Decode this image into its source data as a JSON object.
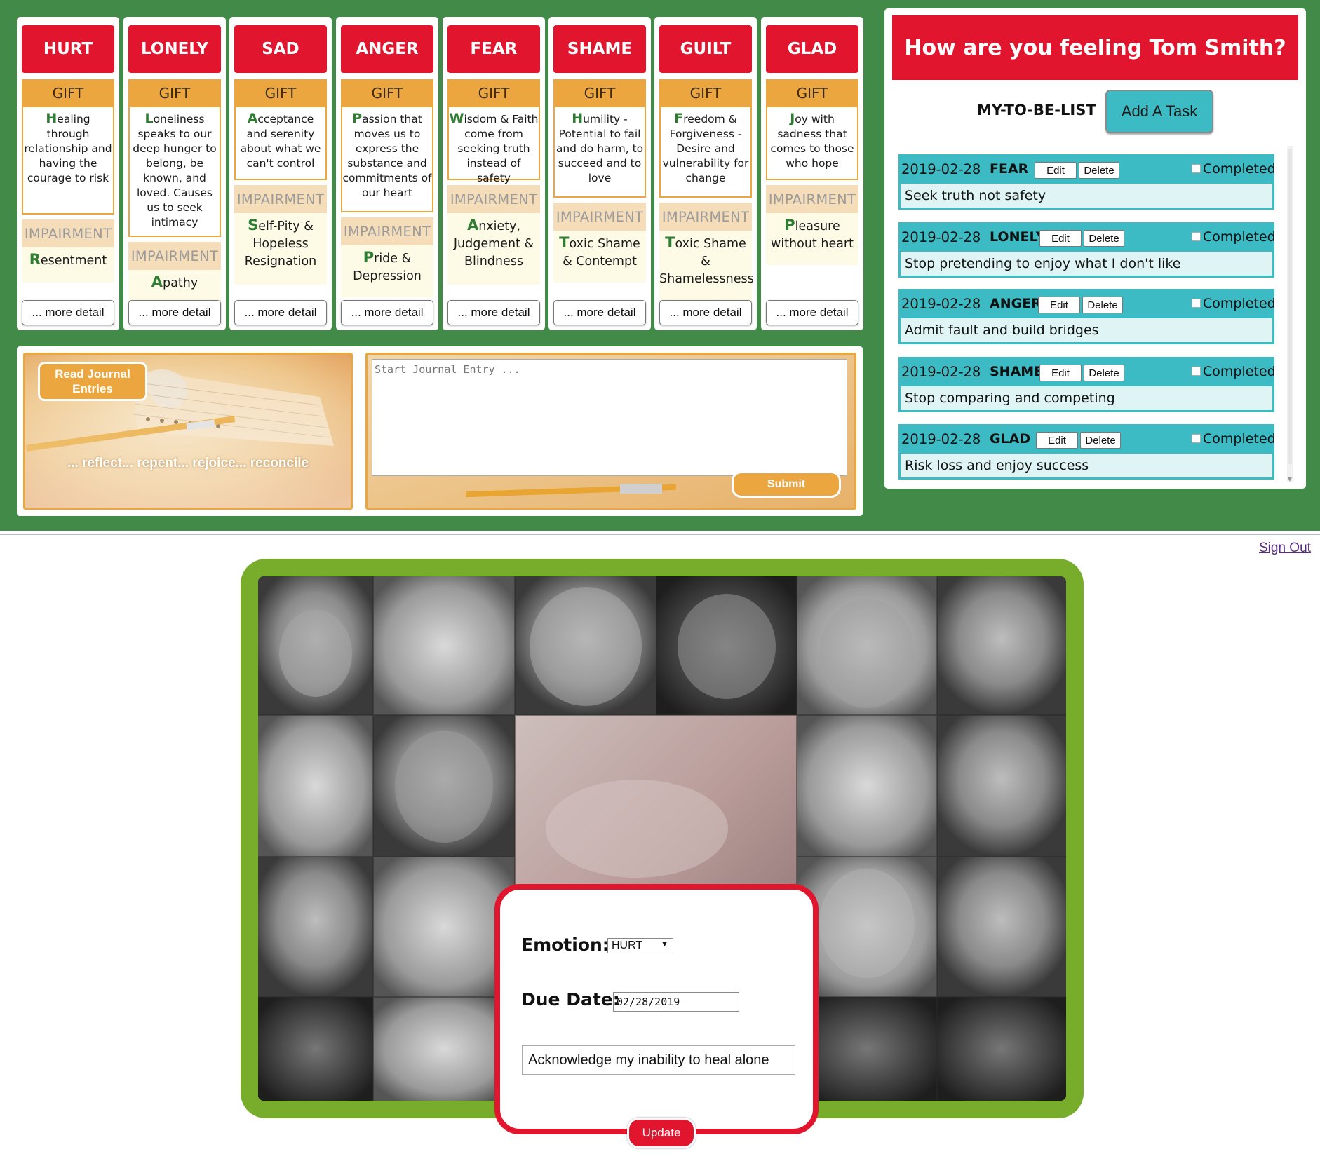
{
  "emotions": [
    {
      "name": "HURT",
      "gift_label": "GIFT",
      "gift_first": "H",
      "gift_rest": "ealing through relationship and having the courage to risk",
      "impairment_label": "IMPAIRMENT",
      "impairment_first": "R",
      "impairment_rest": "esentment",
      "more": "... more detail"
    },
    {
      "name": "LONELY",
      "gift_label": "GIFT",
      "gift_first": "L",
      "gift_rest": "oneliness speaks to our deep hunger to belong, be known, and loved. Causes us to seek intimacy",
      "impairment_label": "IMPAIRMENT",
      "impairment_first": "A",
      "impairment_rest": "pathy",
      "more": "... more detail"
    },
    {
      "name": "SAD",
      "gift_label": "GIFT",
      "gift_first": "A",
      "gift_rest": "cceptance and serenity about what we can't control",
      "impairment_label": "IMPAIRMENT",
      "impairment_first": "S",
      "impairment_rest": "elf-Pity & Hopeless Resignation",
      "more": "... more detail"
    },
    {
      "name": "ANGER",
      "gift_label": "GIFT",
      "gift_first": "P",
      "gift_rest": "assion that moves us to express the substance and commitments of our heart",
      "impairment_label": "IMPAIRMENT",
      "impairment_first": "P",
      "impairment_rest": "ride & Depression",
      "more": "... more detail"
    },
    {
      "name": "FEAR",
      "gift_label": "GIFT",
      "gift_first": "W",
      "gift_rest": "isdom & Faith come from seeking truth instead of safety",
      "impairment_label": "IMPAIRMENT",
      "impairment_first": "A",
      "impairment_rest": "nxiety, Judgement & Blindness",
      "more": "... more detail"
    },
    {
      "name": "SHAME",
      "gift_label": "GIFT",
      "gift_first": "H",
      "gift_rest": "umility - Potential to fail and do harm, to succeed and to love",
      "impairment_label": "IMPAIRMENT",
      "impairment_first": "T",
      "impairment_rest": "oxic Shame & Contempt",
      "more": "... more detail"
    },
    {
      "name": "GUILT",
      "gift_label": "GIFT",
      "gift_first": "F",
      "gift_rest": "reedom & Forgiveness - Desire and vulnerability for change",
      "impairment_label": "IMPAIRMENT",
      "impairment_first": "T",
      "impairment_rest": "oxic Shame & Shamelessness",
      "more": "... more detail"
    },
    {
      "name": "GLAD",
      "gift_label": "GIFT",
      "gift_first": "J",
      "gift_rest": "oy with sadness that comes to those who hope",
      "impairment_label": "IMPAIRMENT",
      "impairment_first": "P",
      "impairment_rest": "leasure without heart",
      "more": "... more detail"
    }
  ],
  "journal": {
    "read_button": "Read Journal Entries",
    "tagline": "... reflect... repent... rejoice... reconcile",
    "placeholder": "Start Journal Entry ...",
    "submit": "Submit"
  },
  "panel": {
    "title": "How are you feeling Tom Smith?",
    "list_label": "MY-TO-BE-LIST",
    "add_task": "Add A Task",
    "edit_label": "Edit",
    "delete_label": "Delete",
    "completed_label": "Completed",
    "tasks": [
      {
        "date": "2019-02-28",
        "emotion": "FEAR",
        "text": "Seek truth not safety"
      },
      {
        "date": "2019-02-28",
        "emotion": "LONELY",
        "text": "Stop pretending to enjoy what I don't like"
      },
      {
        "date": "2019-02-28",
        "emotion": "ANGER",
        "text": "Admit fault and build bridges"
      },
      {
        "date": "2019-02-28",
        "emotion": "SHAME",
        "text": "Stop comparing and competing"
      },
      {
        "date": "2019-02-28",
        "emotion": "GLAD",
        "text": "Risk loss and enjoy success"
      }
    ]
  },
  "signout": "Sign Out",
  "form": {
    "emotion_label": "Emotion:",
    "emotion_value": "HURT",
    "due_label": "Due Date:",
    "due_value": "02/28/2019",
    "description": "Acknowledge my inability to heal alone",
    "update": "Update"
  },
  "colors": {
    "green_band": "#428a47",
    "red": "#e2152e",
    "orange": "#eba63f",
    "teal": "#3cbbc4",
    "frame_green": "#78ad2c"
  }
}
